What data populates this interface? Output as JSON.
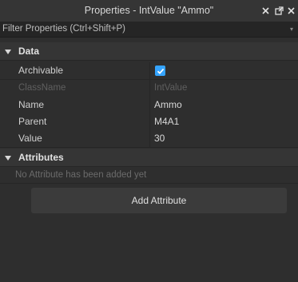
{
  "window": {
    "title": "Properties - IntValue \"Ammo\"",
    "buttons": [
      {
        "name": "close",
        "glyph": "✕"
      },
      {
        "name": "popout",
        "glyph": "⧉"
      },
      {
        "name": "close-x",
        "glyph": "✕"
      }
    ]
  },
  "filter": {
    "placeholder": "Filter Properties (Ctrl+Shift+P)",
    "value": ""
  },
  "sections": {
    "data": {
      "label": "Data"
    },
    "attributes": {
      "label": "Attributes"
    }
  },
  "properties": [
    {
      "name": "Archivable",
      "value": "",
      "checked": true
    },
    {
      "name": "ClassName",
      "value": "IntValue",
      "disabled": true
    },
    {
      "name": "Name",
      "value": "Ammo"
    },
    {
      "name": "Parent",
      "value": "M4A1"
    },
    {
      "name": "Value",
      "value": "30"
    }
  ],
  "attributes": {
    "empty_message": "No Attribute has been added yet",
    "add_label": "Add Attribute"
  },
  "colors": {
    "background": "#2e2e2e",
    "header": "#353535",
    "checkbox": "#35a4ff"
  },
  "icons": [
    "chevron-down-icon",
    "close-icon",
    "popout-icon",
    "checkmark-icon",
    "dropdown-caret-icon"
  ]
}
